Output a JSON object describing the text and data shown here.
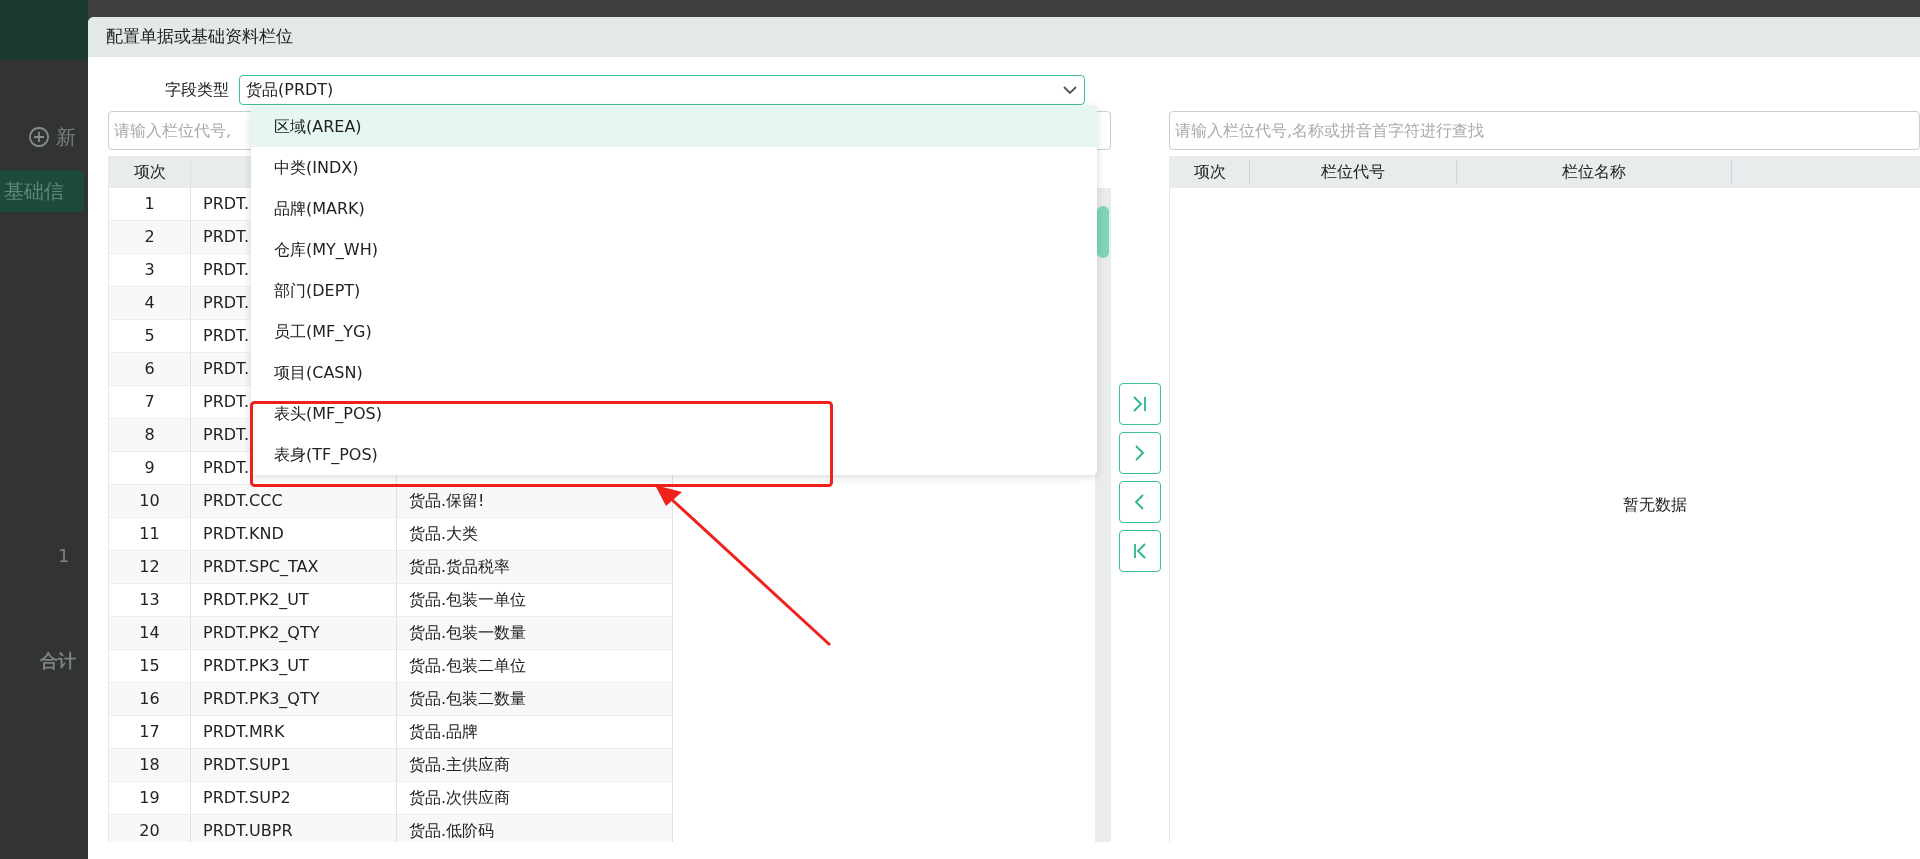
{
  "background": {
    "new_label": "新",
    "tab_label": "基础信",
    "row_number": "1",
    "total_label": "合计"
  },
  "dialog": {
    "title": "配置单据或基础资料栏位",
    "field_type": {
      "label": "字段类型",
      "value": "货品(PRDT)",
      "options": [
        {
          "label": "区域(AREA)",
          "selected": true
        },
        {
          "label": "中类(INDX)",
          "selected": false
        },
        {
          "label": "品牌(MARK)",
          "selected": false
        },
        {
          "label": "仓库(MY_WH)",
          "selected": false
        },
        {
          "label": "部门(DEPT)",
          "selected": false
        },
        {
          "label": "员工(MF_YG)",
          "selected": false
        },
        {
          "label": "项目(CASN)",
          "selected": false
        },
        {
          "label": "表头(MF_POS)",
          "selected": false
        },
        {
          "label": "表身(TF_POS)",
          "selected": false
        }
      ]
    },
    "left_table": {
      "search_placeholder": "请输入栏位代号,",
      "columns": [
        "项次"
      ],
      "rows": [
        {
          "index": "1",
          "code": "PRDT."
        },
        {
          "index": "2",
          "code": "PRDT."
        },
        {
          "index": "3",
          "code": "PRDT."
        },
        {
          "index": "4",
          "code": "PRDT."
        },
        {
          "index": "5",
          "code": "PRDT."
        },
        {
          "index": "6",
          "code": "PRDT."
        },
        {
          "index": "7",
          "code": "PRDT."
        },
        {
          "index": "8",
          "code": "PRDT."
        },
        {
          "index": "9",
          "code": "PRDT."
        },
        {
          "index": "10",
          "code": "PRDT.CCC",
          "name": "货品.保留!"
        },
        {
          "index": "11",
          "code": "PRDT.KND",
          "name": "货品.大类"
        },
        {
          "index": "12",
          "code": "PRDT.SPC_TAX",
          "name": "货品.货品税率"
        },
        {
          "index": "13",
          "code": "PRDT.PK2_UT",
          "name": "货品.包装一单位"
        },
        {
          "index": "14",
          "code": "PRDT.PK2_QTY",
          "name": "货品.包装一数量"
        },
        {
          "index": "15",
          "code": "PRDT.PK3_UT",
          "name": "货品.包装二单位"
        },
        {
          "index": "16",
          "code": "PRDT.PK3_QTY",
          "name": "货品.包装二数量"
        },
        {
          "index": "17",
          "code": "PRDT.MRK",
          "name": "货品.品牌"
        },
        {
          "index": "18",
          "code": "PRDT.SUP1",
          "name": "货品.主供应商"
        },
        {
          "index": "19",
          "code": "PRDT.SUP2",
          "name": "货品.次供应商"
        },
        {
          "index": "20",
          "code": "PRDT.UBPR",
          "name": "货品.低阶码"
        }
      ]
    },
    "transfer_buttons": [
      {
        "kind": "all-right"
      },
      {
        "kind": "right"
      },
      {
        "kind": "left"
      },
      {
        "kind": "all-left"
      }
    ],
    "right_table": {
      "search_placeholder": "请输入栏位代号,名称或拼音首字符进行查找",
      "columns": [
        "项次",
        "栏位代号",
        "栏位名称"
      ],
      "empty_text": "暂无数据"
    }
  }
}
